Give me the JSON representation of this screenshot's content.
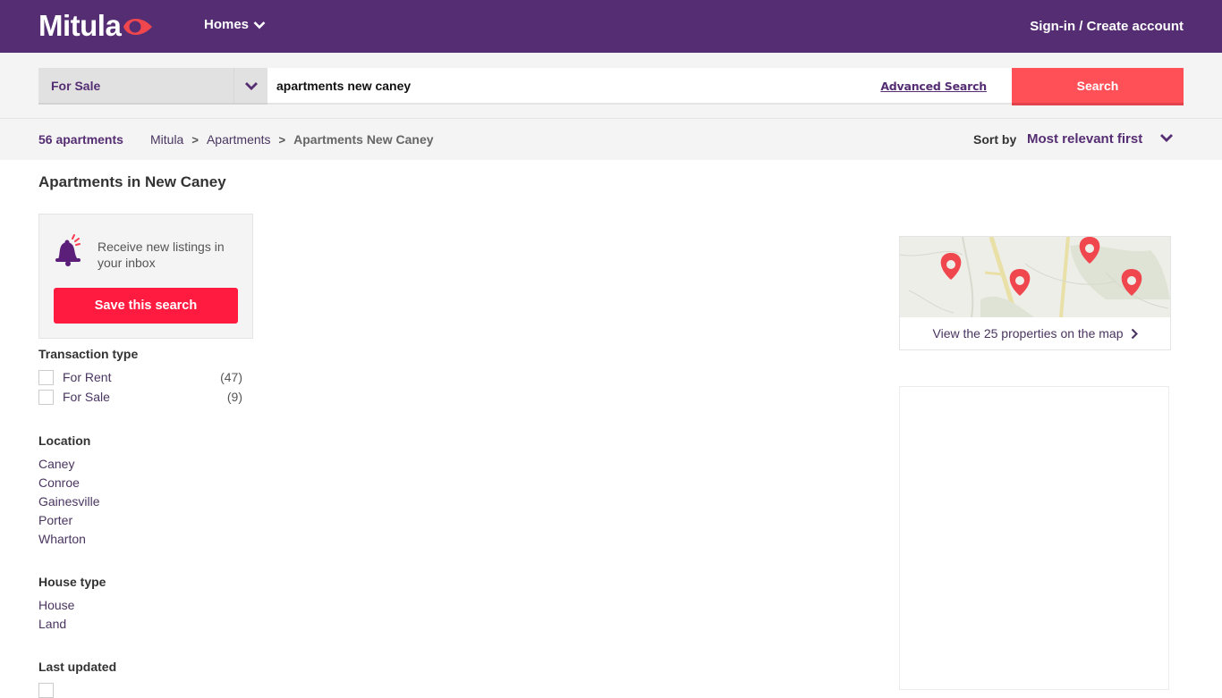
{
  "header": {
    "logo_text": "Mitula",
    "homes_menu": "Homes",
    "signin": "Sign-in / Create account"
  },
  "search": {
    "transaction_selected": "For Sale",
    "query": "apartments new caney",
    "advanced_label": "Advanced Search",
    "button_label": "Search"
  },
  "results": {
    "count": "56 apartments",
    "breadcrumb": [
      {
        "label": "Mitula"
      },
      {
        "label": "Apartments"
      },
      {
        "label": "Apartments New Caney"
      }
    ],
    "breadcrumb_separator": ">",
    "sort_label": "Sort by",
    "sort_value": "Most relevant first"
  },
  "page_title": "Apartments in New Caney",
  "alert": {
    "text": "Receive new listings in your inbox",
    "button": "Save this search"
  },
  "filters": {
    "transaction": {
      "title": "Transaction type",
      "options": [
        {
          "label": "For Rent",
          "count": "(47)",
          "checked": false
        },
        {
          "label": "For Sale",
          "count": "(9)",
          "checked": false
        }
      ]
    },
    "location": {
      "title": "Location",
      "items": [
        "Caney",
        "Conroe",
        "Gainesville",
        "Porter",
        "Wharton"
      ]
    },
    "house_type": {
      "title": "House type",
      "items": [
        "House",
        "Land"
      ]
    },
    "last_updated": {
      "title": "Last updated"
    }
  },
  "map": {
    "link_text": "View the 25 properties on the map",
    "pin_color": "#f0474e"
  },
  "colors": {
    "brand_purple": "#552d72",
    "search_red": "#ff5058",
    "save_red": "#ff1a40"
  }
}
